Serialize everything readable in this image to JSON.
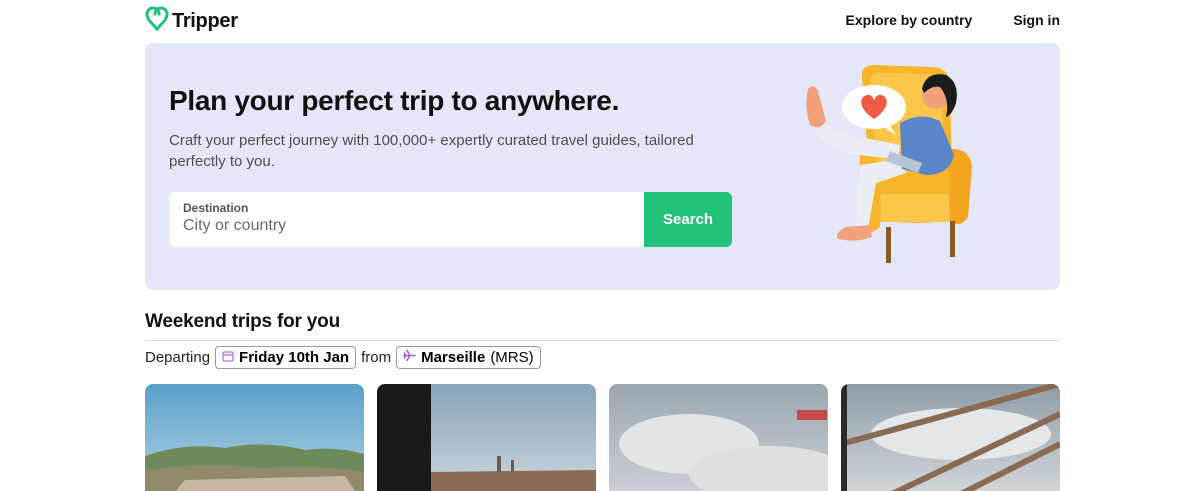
{
  "header": {
    "logo_text": "Tripper",
    "nav": {
      "explore": "Explore by country",
      "signin": "Sign in"
    }
  },
  "hero": {
    "title": "Plan your perfect trip to anywhere.",
    "subtitle": "Craft your perfect journey with 100,000+ expertly curated travel guides, tailored perfectly to you.",
    "search": {
      "label": "Destination",
      "placeholder": "City or country",
      "value": "",
      "button": "Search"
    }
  },
  "weekend": {
    "title": "Weekend trips for you",
    "departing_label": "Departing",
    "date": "Friday 10th Jan",
    "from_label": "from",
    "origin_city": "Marseille",
    "origin_code": "(MRS)"
  },
  "icons": {
    "logo": "tripper-logo-icon",
    "calendar": "calendar-icon",
    "plane": "plane-icon"
  },
  "colors": {
    "brand_green": "#21c27a",
    "hero_bg": "#e4e7f7",
    "text_dark": "#111111",
    "calendar_icon": "#c06bd8",
    "plane_icon": "#a55bd0"
  }
}
